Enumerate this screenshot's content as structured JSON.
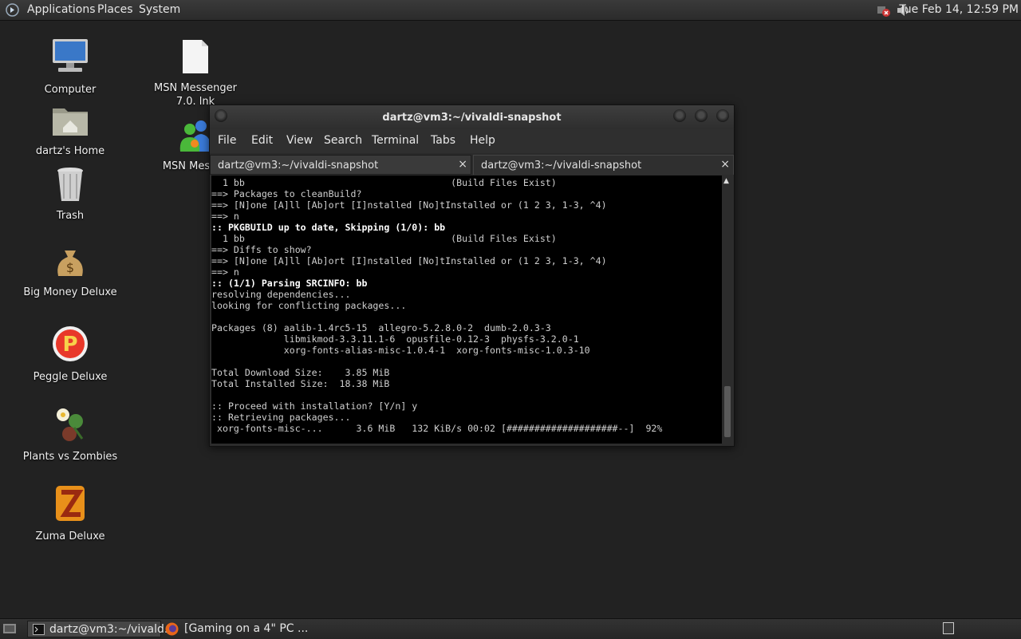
{
  "top_panel": {
    "menus": [
      "Applications",
      "Places",
      "System"
    ],
    "clock": "Tue Feb 14, 12:59 PM"
  },
  "desktop": {
    "icons": [
      {
        "label": "Computer",
        "icon": "computer-icon"
      },
      {
        "label": "dartz's Home",
        "icon": "home-folder-icon"
      },
      {
        "label": "Trash",
        "icon": "trash-icon"
      },
      {
        "label": "Big Money Deluxe",
        "icon": "money-bag-icon"
      },
      {
        "label": "Peggle Deluxe",
        "icon": "peggle-icon"
      },
      {
        "label": "Plants vs Zombies",
        "icon": "plants-vs-zombies-icon"
      },
      {
        "label": "Zuma Deluxe",
        "icon": "zuma-icon"
      },
      {
        "label": "MSN Messenger 7.0. lnk",
        "icon": "file-icon"
      },
      {
        "label": "MSN Messen",
        "icon": "msn-messenger-icon"
      }
    ]
  },
  "window": {
    "title": "dartz@vm3:~/vivaldi-snapshot",
    "menu": [
      "File",
      "Edit",
      "View",
      "Search",
      "Terminal",
      "Tabs",
      "Help"
    ],
    "tabs": [
      {
        "label": "dartz@vm3:~/vivaldi-snapshot",
        "active": false
      },
      {
        "label": "dartz@vm3:~/vivaldi-snapshot",
        "active": true
      }
    ],
    "tab_close": "×"
  },
  "terminal": {
    "lines": [
      {
        "text": "  1 bb                                     (Build Files Exist)",
        "bold": false
      },
      {
        "text": "==> Packages to cleanBuild?",
        "bold": false
      },
      {
        "text": "==> [N]one [A]ll [Ab]ort [I]nstalled [No]tInstalled or (1 2 3, 1-3, ^4)",
        "bold": false
      },
      {
        "text": "==> n",
        "bold": false
      },
      {
        "text": ":: PKGBUILD up to date, Skipping (1/0): bb",
        "bold": true
      },
      {
        "text": "  1 bb                                     (Build Files Exist)",
        "bold": false
      },
      {
        "text": "==> Diffs to show?",
        "bold": false
      },
      {
        "text": "==> [N]one [A]ll [Ab]ort [I]nstalled [No]tInstalled or (1 2 3, 1-3, ^4)",
        "bold": false
      },
      {
        "text": "==> n",
        "bold": false
      },
      {
        "text": ":: (1/1) Parsing SRCINFO: bb",
        "bold": true
      },
      {
        "text": "resolving dependencies...",
        "bold": false
      },
      {
        "text": "looking for conflicting packages...",
        "bold": false
      },
      {
        "text": "",
        "bold": false
      },
      {
        "text": "Packages (8) aalib-1.4rc5-15  allegro-5.2.8.0-2  dumb-2.0.3-3",
        "bold": false
      },
      {
        "text": "             libmikmod-3.3.11.1-6  opusfile-0.12-3  physfs-3.2.0-1",
        "bold": false
      },
      {
        "text": "             xorg-fonts-alias-misc-1.0.4-1  xorg-fonts-misc-1.0.3-10",
        "bold": false
      },
      {
        "text": "",
        "bold": false
      },
      {
        "text": "Total Download Size:    3.85 MiB",
        "bold": false
      },
      {
        "text": "Total Installed Size:  18.38 MiB",
        "bold": false
      },
      {
        "text": "",
        "bold": false
      },
      {
        "text": ":: Proceed with installation? [Y/n] y",
        "bold": false
      },
      {
        "text": ":: Retrieving packages...",
        "bold": false
      },
      {
        "text": " xorg-fonts-misc-...      3.6 MiB   132 KiB/s 00:02 [####################--]  92%",
        "bold": false
      }
    ]
  },
  "bottom_panel": {
    "tasks": [
      {
        "label": "dartz@vm3:~/vivald...",
        "icon": "terminal-icon",
        "active": true
      },
      {
        "label": "[Gaming on a 4\" PC ...",
        "icon": "firefox-icon",
        "active": false
      }
    ]
  }
}
